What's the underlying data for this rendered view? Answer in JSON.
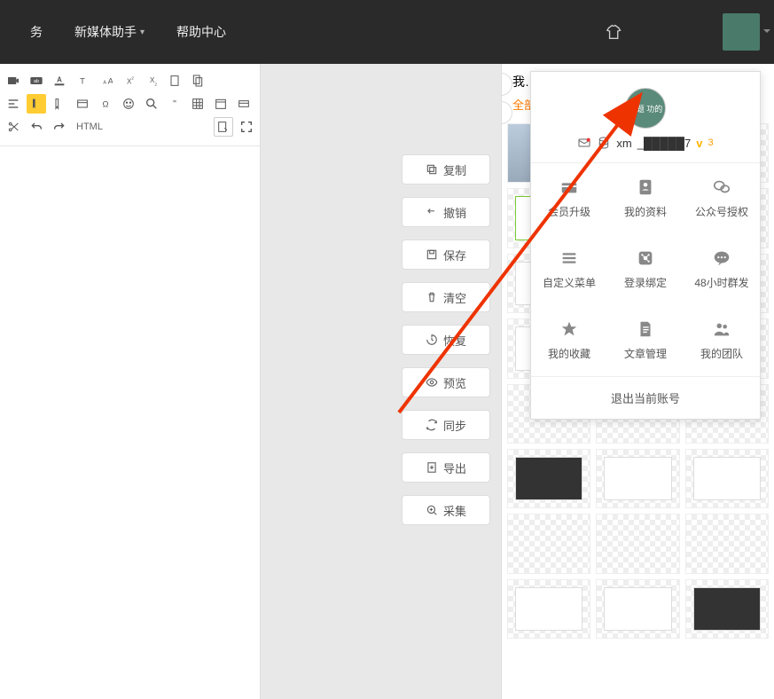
{
  "topnav": {
    "item1": "务",
    "item2": "新媒体助手",
    "item3": "帮助中心"
  },
  "actions": {
    "copy": "复制",
    "undo": "撤销",
    "save": "保存",
    "clear": "清空",
    "restore": "恢复",
    "preview": "预览",
    "sync": "同步",
    "export": "导出",
    "collect": "采集"
  },
  "right": {
    "title": "我…",
    "filter": "全部",
    "collapse": "»",
    "magic": "✦"
  },
  "user": {
    "avatar_text": "标题\n功的",
    "name_prefix": "xm",
    "name_mask": "_█████7",
    "vbadge": "v",
    "vnum": "3",
    "menu": {
      "upgrade": "会员升级",
      "profile": "我的资料",
      "auth": "公众号授权",
      "menu": "自定义菜单",
      "bind": "登录绑定",
      "mass": "48小时群发",
      "fav": "我的收藏",
      "article": "文章管理",
      "team": "我的团队"
    },
    "logout": "退出当前账号"
  },
  "toolbar": {
    "html": "HTML"
  }
}
